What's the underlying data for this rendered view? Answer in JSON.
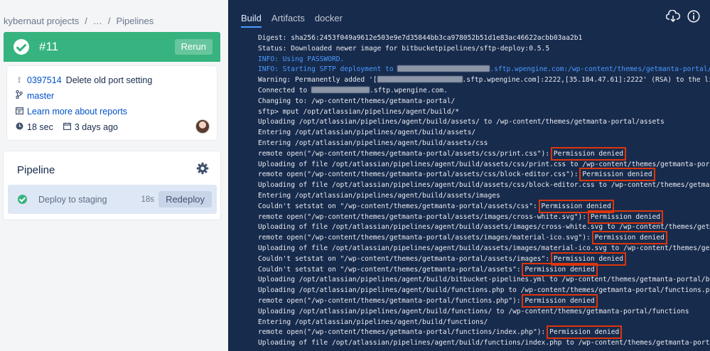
{
  "breadcrumb": [
    "kybernaut projects",
    "/",
    "…",
    "/",
    "Pipelines"
  ],
  "run": {
    "number": "#11",
    "rerun_label": "Rerun",
    "status_color": "#36b37e"
  },
  "commit": {
    "hash": "0397514",
    "message": "Delete old port setting"
  },
  "branch": "master",
  "reports_link": "Learn more about reports",
  "duration": "18 sec",
  "ago": "3 days ago",
  "pipeline": {
    "title": "Pipeline",
    "step": {
      "name": "Deploy to staging",
      "duration": "18s",
      "redeploy_label": "Redeploy"
    }
  },
  "log_tabs": [
    "Build",
    "Artifacts",
    "docker"
  ],
  "log": [
    {
      "text": "Digest: sha256:2453f049a9612e503e9e7d35844bb3ca978052b51d1e83ac46622acbb03aa2b1"
    },
    {
      "text": "Status: Downloaded newer image for bitbucketpipelines/sftp-deploy:0.5.5"
    },
    {
      "text": "INFO: Using PASSWORD.",
      "type": "info"
    },
    {
      "text": "INFO: Starting SFTP deployment to ",
      "redact": "r1",
      "after": ".sftp.wpengine.com:/wp-content/themes/getmanta-portal/...",
      "type": "info"
    },
    {
      "text": "Warning: Permanently added '[",
      "redact": "r2",
      "after": ".sftp.wpengine.com]:2222,[35.184.47.61]:2222' (RSA) to the list of known hosts."
    },
    {
      "text": "Connected to ",
      "redact": "r3",
      "after": ".sftp.wpengine.com."
    },
    {
      "text": "Changing to: /wp-content/themes/getmanta-portal/"
    },
    {
      "text": "sftp> mput /opt/atlassian/pipelines/agent/build/*"
    },
    {
      "text": "Uploading /opt/atlassian/pipelines/agent/build/assets/ to /wp-content/themes/getmanta-portal/assets"
    },
    {
      "text": "Entering /opt/atlassian/pipelines/agent/build/assets/"
    },
    {
      "text": "Entering /opt/atlassian/pipelines/agent/build/assets/css"
    },
    {
      "text": "remote open(\"/wp-content/themes/getmanta-portal/assets/css/print.css\"): ",
      "denied": "Permission denied"
    },
    {
      "text": "Uploading of file /opt/atlassian/pipelines/agent/build/assets/css/print.css to /wp-content/themes/getmanta-portal/assets/css/print.css"
    },
    {
      "text": "remote open(\"/wp-content/themes/getmanta-portal/assets/css/block-editor.css\"): ",
      "denied": "Permission denied"
    },
    {
      "text": "Uploading of file /opt/atlassian/pipelines/agent/build/assets/css/block-editor.css to /wp-content/themes/getmanta-portal/assets/css"
    },
    {
      "text": "Entering /opt/atlassian/pipelines/agent/build/assets/images"
    },
    {
      "text": "Couldn't setstat on \"/wp-content/themes/getmanta-portal/assets/css\": ",
      "denied": "Permission denied"
    },
    {
      "text": "remote open(\"/wp-content/themes/getmanta-portal/assets/images/cross-white.svg\"): ",
      "denied": "Permission denied"
    },
    {
      "text": "Uploading of file /opt/atlassian/pipelines/agent/build/assets/images/cross-white.svg to /wp-content/themes/getmanta-portal/assets"
    },
    {
      "text": "remote open(\"/wp-content/themes/getmanta-portal/assets/images/material-ico.svg\"): ",
      "denied": "Permission denied"
    },
    {
      "text": "Uploading of file /opt/atlassian/pipelines/agent/build/assets/images/material-ico.svg to /wp-content/themes/getmanta-portal/assets"
    },
    {
      "text": "Couldn't setstat on \"/wp-content/themes/getmanta-portal/assets/images\": ",
      "denied": "Permission denied"
    },
    {
      "text": "Couldn't setstat on \"/wp-content/themes/getmanta-portal/assets\": ",
      "denied": "Permission denied"
    },
    {
      "text": "Uploading /opt/atlassian/pipelines/agent/build/bitbucket-pipelines.yml to /wp-content/themes/getmanta-portal/bitbucket-pipelines.yml"
    },
    {
      "text": "Uploading /opt/atlassian/pipelines/agent/build/functions.php to /wp-content/themes/getmanta-portal/functions.php"
    },
    {
      "text": "remote open(\"/wp-content/themes/getmanta-portal/functions.php\"): ",
      "denied": "Permission denied"
    },
    {
      "text": "Uploading /opt/atlassian/pipelines/agent/build/functions/ to /wp-content/themes/getmanta-portal/functions"
    },
    {
      "text": "Entering /opt/atlassian/pipelines/agent/build/functions/"
    },
    {
      "text": "remote open(\"/wp-content/themes/getmanta-portal/functions/index.php\"): ",
      "denied": "Permission denied"
    },
    {
      "text": "Uploading of file /opt/atlassian/pipelines/agent/build/functions/index.php to /wp-content/themes/getmanta-portal/functions"
    }
  ]
}
